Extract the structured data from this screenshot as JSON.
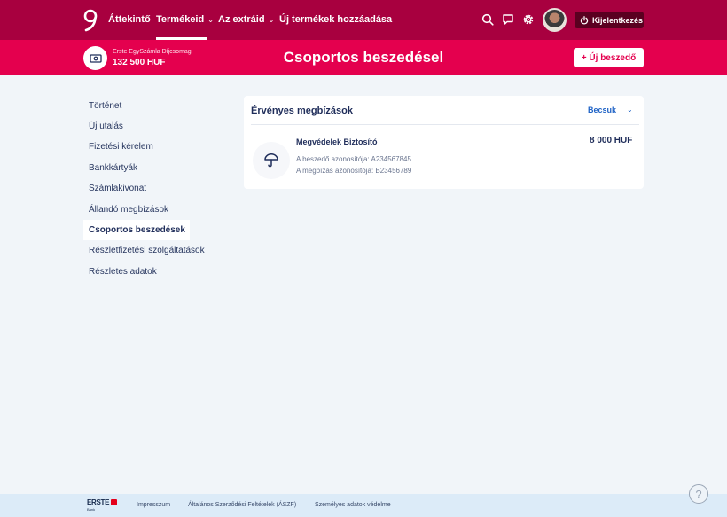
{
  "nav": {
    "items": [
      {
        "label": "Áttekintő",
        "chevron": false
      },
      {
        "label": "Termékeid",
        "chevron": true
      },
      {
        "label": "Az extráid",
        "chevron": true
      },
      {
        "label": "Új termékek hozzáadása",
        "chevron": false
      }
    ],
    "active": "Termékeid",
    "logout_label": "Kijelentkezés",
    "icons": [
      "search-icon",
      "chat-icon",
      "gear-icon",
      "avatar",
      "power-icon"
    ]
  },
  "account": {
    "name": "Erste EgySzámla Díjcsomag",
    "balance": "132 500 HUF"
  },
  "page": {
    "title": "Csoportos beszedésel",
    "new_button": "+ Új beszedő"
  },
  "sidebar": {
    "items": [
      "Történet",
      "Új utalás",
      "Fizetési kérelem",
      "Bankkártyák",
      "Számlakivonat",
      "Állandó megbízások",
      "Csoportos beszedések",
      "Részletfizetési szolgáltatások",
      "Részletes adatok"
    ],
    "active_index": 6
  },
  "mandates": {
    "title": "Érvényes megbízások",
    "collapse_label": "Becsuk",
    "items": [
      {
        "name": "Megvédelek Biztosító",
        "amount": "8 000 HUF",
        "collector_id": "A beszedő azonosítója: A234567845",
        "mandate_id": "A megbízás azonosítója: B23456789",
        "icon": "umbrella-icon"
      }
    ]
  },
  "footer": {
    "brand": "ERSTE",
    "brand_sub": "Bank",
    "links": [
      "Impresszum",
      "Általános Szerződési Feltételek (ÁSZF)",
      "Személyes adatok védelme"
    ],
    "help": "?"
  },
  "colors": {
    "nav_bg": "#a8003f",
    "accent": "#e4004e",
    "link_blue": "#1f63c6",
    "page_bg": "#f1f5f9",
    "footer_bg": "#dcebf8"
  }
}
